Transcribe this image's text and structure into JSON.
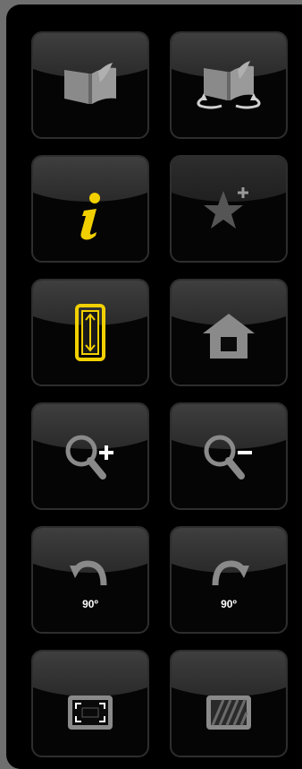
{
  "colors": {
    "background": "#6f6f6f",
    "panel": "#000000",
    "accent": "#f2d000",
    "icon_grey": "#888888",
    "tile_border": "#2e2e2e"
  },
  "buttons": [
    {
      "name": "open-book",
      "icon": "open-book-icon"
    },
    {
      "name": "flip-pages",
      "icon": "flip-pages-icon"
    },
    {
      "name": "info",
      "icon": "info-icon"
    },
    {
      "name": "add-bookmark",
      "icon": "star-plus-icon"
    },
    {
      "name": "fit-height",
      "icon": "fit-height-icon"
    },
    {
      "name": "home",
      "icon": "home-icon"
    },
    {
      "name": "zoom-in",
      "icon": "zoom-in-icon"
    },
    {
      "name": "zoom-out",
      "icon": "zoom-out-icon"
    },
    {
      "name": "rotate-left",
      "icon": "rotate-left-icon",
      "label": "90º"
    },
    {
      "name": "rotate-right",
      "icon": "rotate-right-icon",
      "label": "90º"
    },
    {
      "name": "fullscreen",
      "icon": "fullscreen-icon"
    },
    {
      "name": "thumbnails",
      "icon": "striped-frame-icon"
    }
  ]
}
